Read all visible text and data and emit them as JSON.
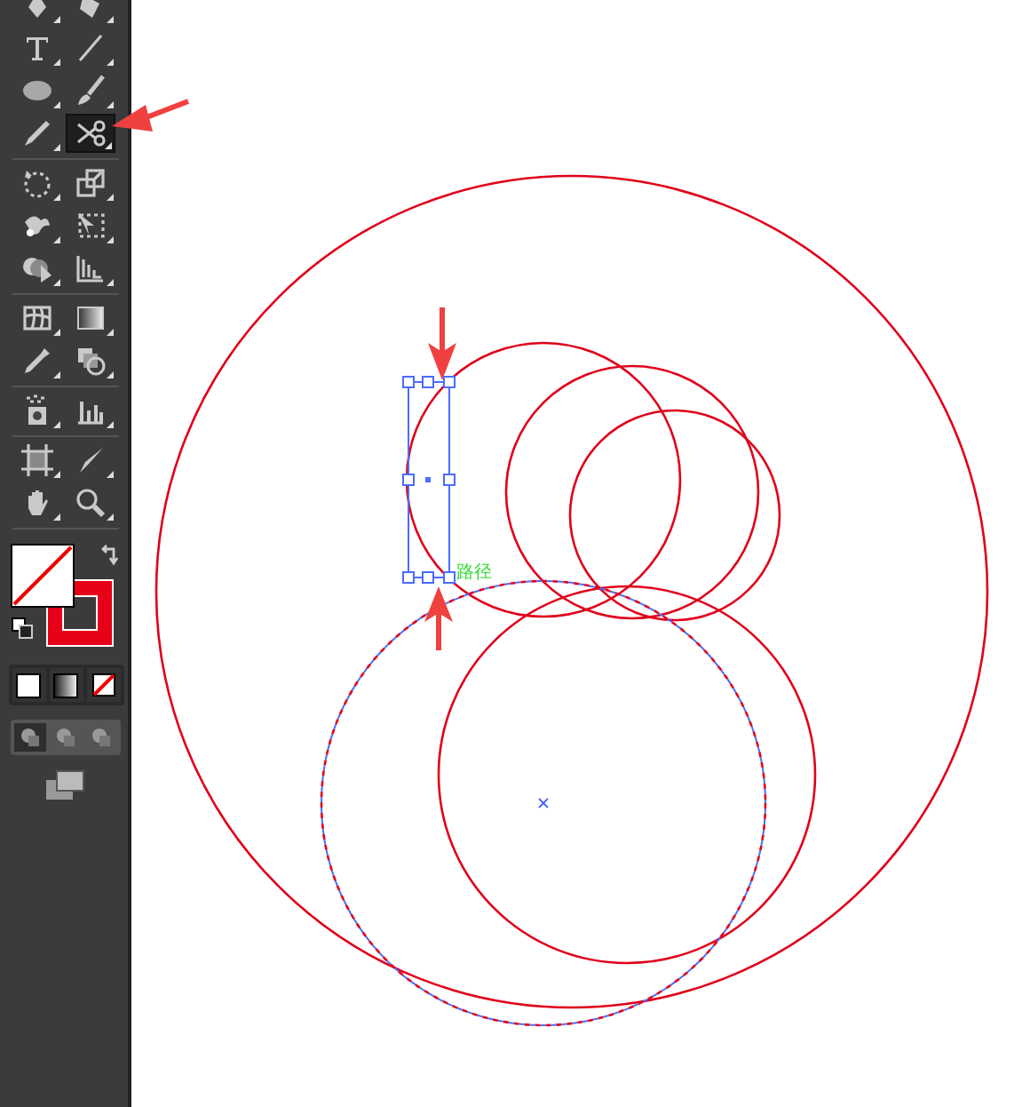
{
  "toolbar": {
    "tool_groups": [
      {
        "tools": [
          {
            "kind": "pen",
            "selected": false
          },
          {
            "kind": "curvature",
            "selected": false
          },
          {
            "kind": "type",
            "selected": false
          },
          {
            "kind": "line",
            "selected": false
          },
          {
            "kind": "ellipse",
            "selected": false
          },
          {
            "kind": "brush",
            "selected": false
          },
          {
            "kind": "pencil",
            "selected": false
          },
          {
            "kind": "scissors",
            "selected": true
          }
        ]
      },
      {
        "tools": [
          {
            "kind": "rotate",
            "selected": false
          },
          {
            "kind": "scale",
            "selected": false
          },
          {
            "kind": "warp",
            "selected": false
          },
          {
            "kind": "free-transform",
            "selected": false
          },
          {
            "kind": "shape-builder",
            "selected": false
          },
          {
            "kind": "perspective",
            "selected": false
          }
        ]
      },
      {
        "tools": [
          {
            "kind": "mesh",
            "selected": false
          },
          {
            "kind": "gradient",
            "selected": false
          },
          {
            "kind": "eyedropper",
            "selected": false
          },
          {
            "kind": "blend",
            "selected": false
          }
        ]
      },
      {
        "tools": [
          {
            "kind": "sprayer",
            "selected": false
          },
          {
            "kind": "graph",
            "selected": false
          }
        ]
      },
      {
        "tools": [
          {
            "kind": "artboard",
            "selected": false
          },
          {
            "kind": "slice",
            "selected": false
          },
          {
            "kind": "hand",
            "selected": false
          },
          {
            "kind": "zoom",
            "selected": false
          }
        ]
      }
    ]
  },
  "canvas": {
    "anchor_label": "路径"
  }
}
